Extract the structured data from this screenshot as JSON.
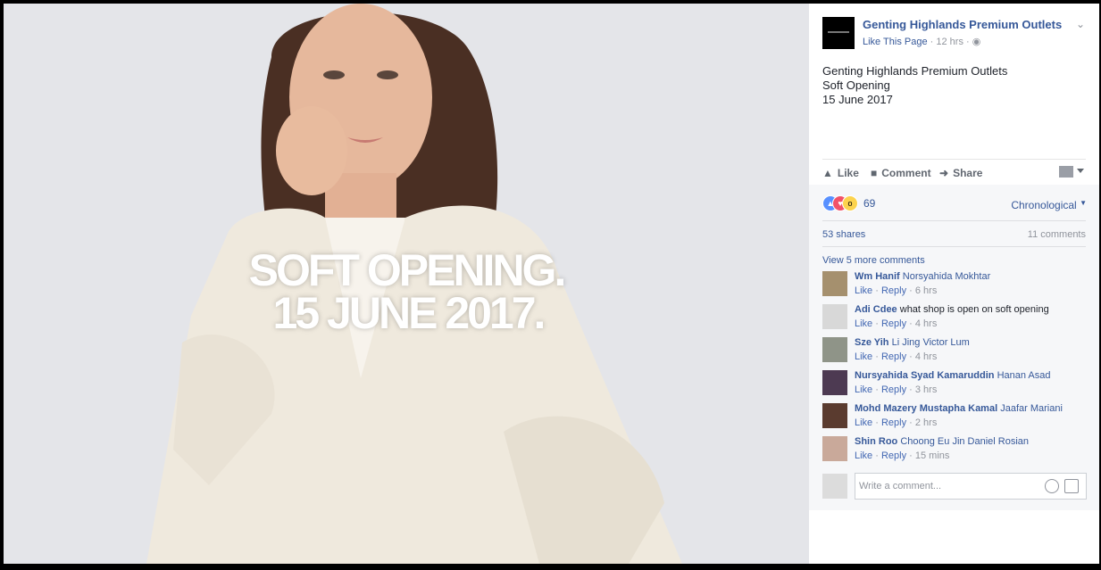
{
  "photo": {
    "overlay_line1": "SOFT OPENING.",
    "overlay_line2": "15 JUNE 2017."
  },
  "post": {
    "page_name": "Genting Highlands Premium Outlets",
    "like_page": "Like This Page",
    "time": "12 hrs",
    "text_lines": [
      "Genting Highlands Premium Outlets",
      "Soft Opening",
      "15 June 2017"
    ]
  },
  "actions": {
    "like": "Like",
    "comment": "Comment",
    "share": "Share"
  },
  "reactions": {
    "count": "69",
    "sort": "Chronological"
  },
  "stats": {
    "shares": "53 shares",
    "comments": "11 comments"
  },
  "view_more": "View 5 more comments",
  "comments": [
    {
      "author": "Wm Hanif",
      "text": "",
      "tag": "Norsyahida Mokhtar",
      "like": "Like",
      "reply": "Reply",
      "time": "6 hrs"
    },
    {
      "author": "Adi Cdee",
      "text": "what shop is open on soft opening",
      "tag": "",
      "like": "Like",
      "reply": "Reply",
      "time": "4 hrs"
    },
    {
      "author": "Sze Yih",
      "text": "",
      "tag": "Li Jing Victor Lum",
      "like": "Like",
      "reply": "Reply",
      "time": "4 hrs"
    },
    {
      "author": "Nursyahida Syad Kamaruddin",
      "text": "",
      "tag": "Hanan Asad",
      "like": "Like",
      "reply": "Reply",
      "time": "3 hrs"
    },
    {
      "author": "Mohd Mazery Mustapha Kamal",
      "text": "",
      "tag": "Jaafar Mariani",
      "like": "Like",
      "reply": "Reply",
      "time": "2 hrs"
    },
    {
      "author": "Shin Roo",
      "text": "",
      "tag": "Choong Eu Jin Daniel Rosian",
      "like": "Like",
      "reply": "Reply",
      "time": "15 mins"
    }
  ],
  "write_placeholder": "Write a comment...",
  "colors": {
    "link": "#365899",
    "meta": "#90949c",
    "photo_bg": "#e4e5e9"
  }
}
